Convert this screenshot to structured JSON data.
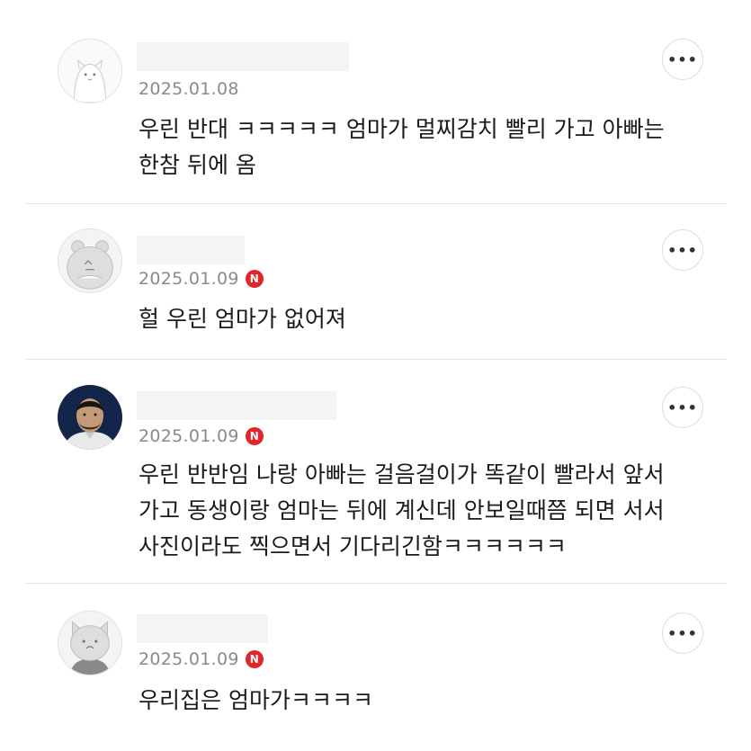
{
  "more_icon": "more-horizontal-icon",
  "badge_color": "#e3242b",
  "comments": [
    {
      "date": "2025.01.08",
      "is_new": false,
      "avatar": "white-cat-avatar",
      "lines": [
        "우린 반대 ㅋㅋㅋㅋㅋ 엄마가 멀찌감치 빨리 가고 아빠는",
        "한참 뒤에 옴"
      ]
    },
    {
      "date": "2025.01.09",
      "is_new": true,
      "badge": "N",
      "avatar": "gray-bear-avatar",
      "lines": [
        "헐 우린 엄마가 없어져"
      ]
    },
    {
      "date": "2025.01.09",
      "is_new": true,
      "badge": "N",
      "avatar": "person-photo-avatar",
      "lines": [
        "우린 반반임 나랑 아빠는 걸음걸이가 똑같이 빨라서 앞서",
        "가고 동생이랑 엄마는 뒤에 계신데 안보일때쯤 되면 서서",
        "사진이라도 찍으면서 기다리긴함ㅋㅋㅋㅋㅋㅋ"
      ]
    },
    {
      "date": "2025.01.09",
      "is_new": true,
      "badge": "N",
      "avatar": "gray-cat-avatar",
      "lines": [
        "우리집은 엄마가ㅋㅋㅋㅋ"
      ]
    }
  ]
}
